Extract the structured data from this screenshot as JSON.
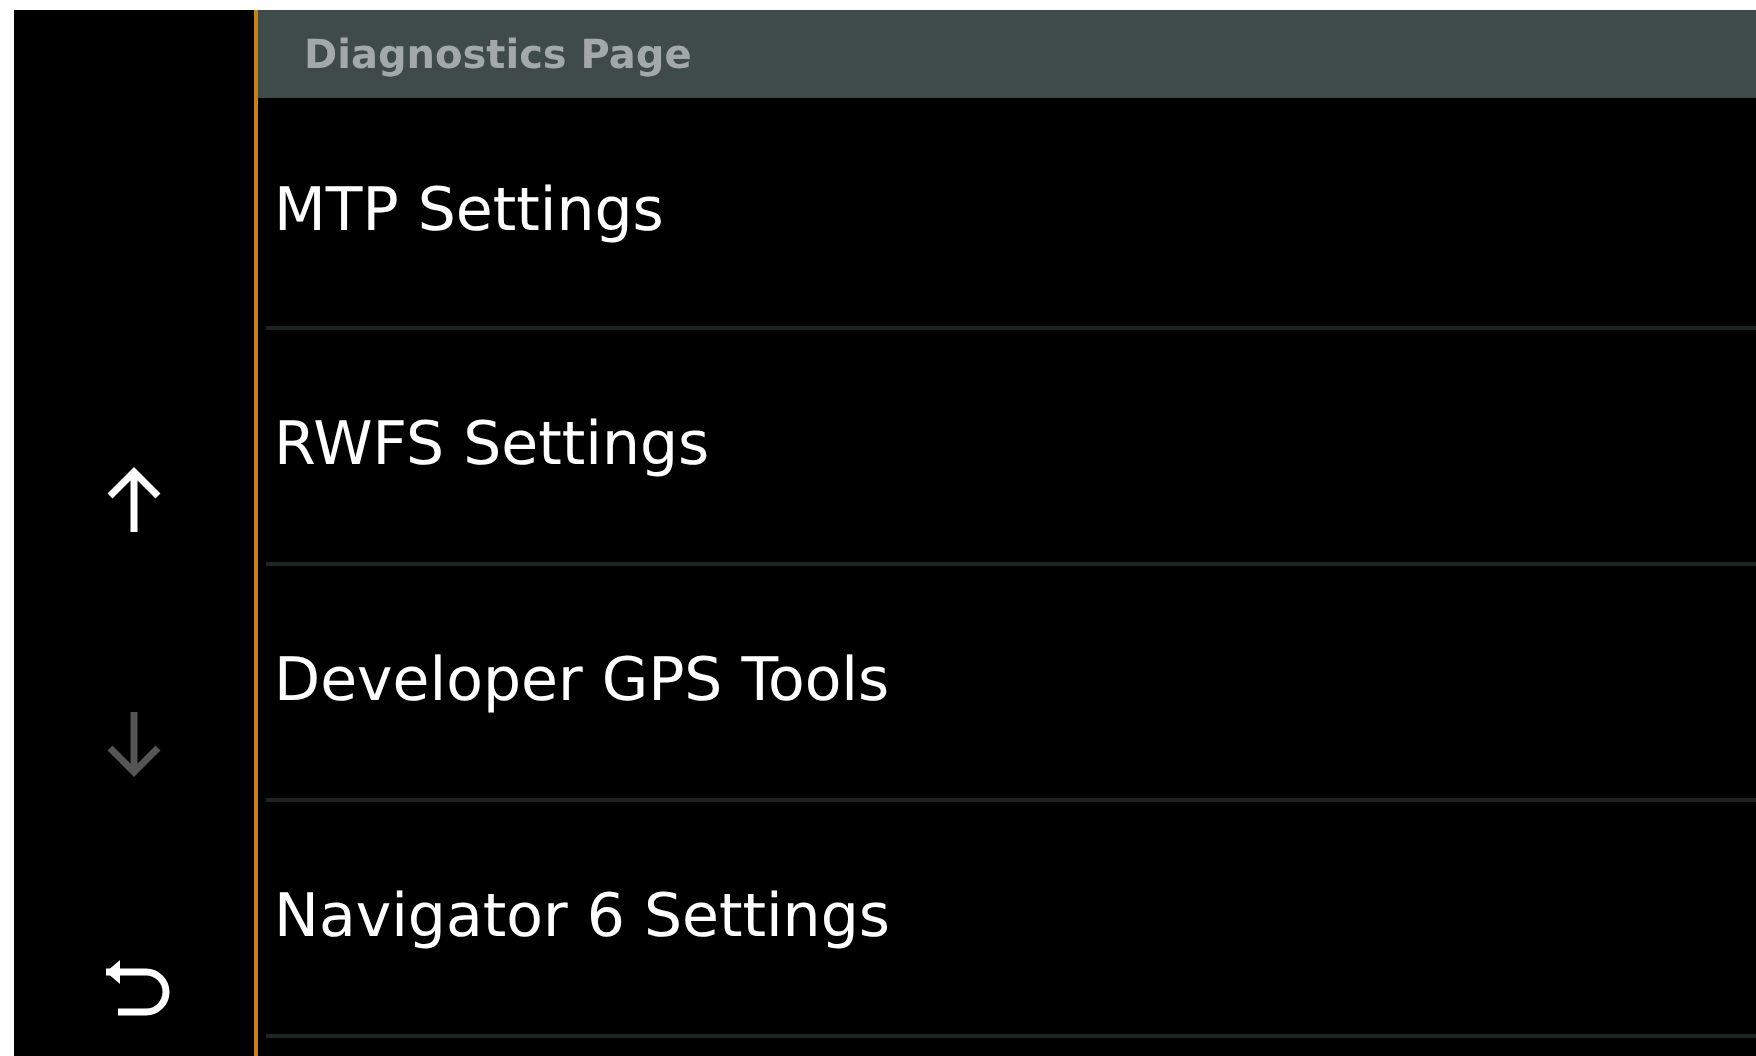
{
  "header": {
    "title": "Diagnostics Page"
  },
  "nav_buttons": [
    {
      "kind": "up",
      "disabled": false
    },
    {
      "kind": "down",
      "disabled": true
    },
    {
      "kind": "back",
      "disabled": false
    }
  ],
  "menu_items": [
    {
      "label": "MTP Settings"
    },
    {
      "label": "RWFS Settings"
    },
    {
      "label": "Developer GPS Tools"
    },
    {
      "label": "Navigator 6 Settings"
    }
  ]
}
